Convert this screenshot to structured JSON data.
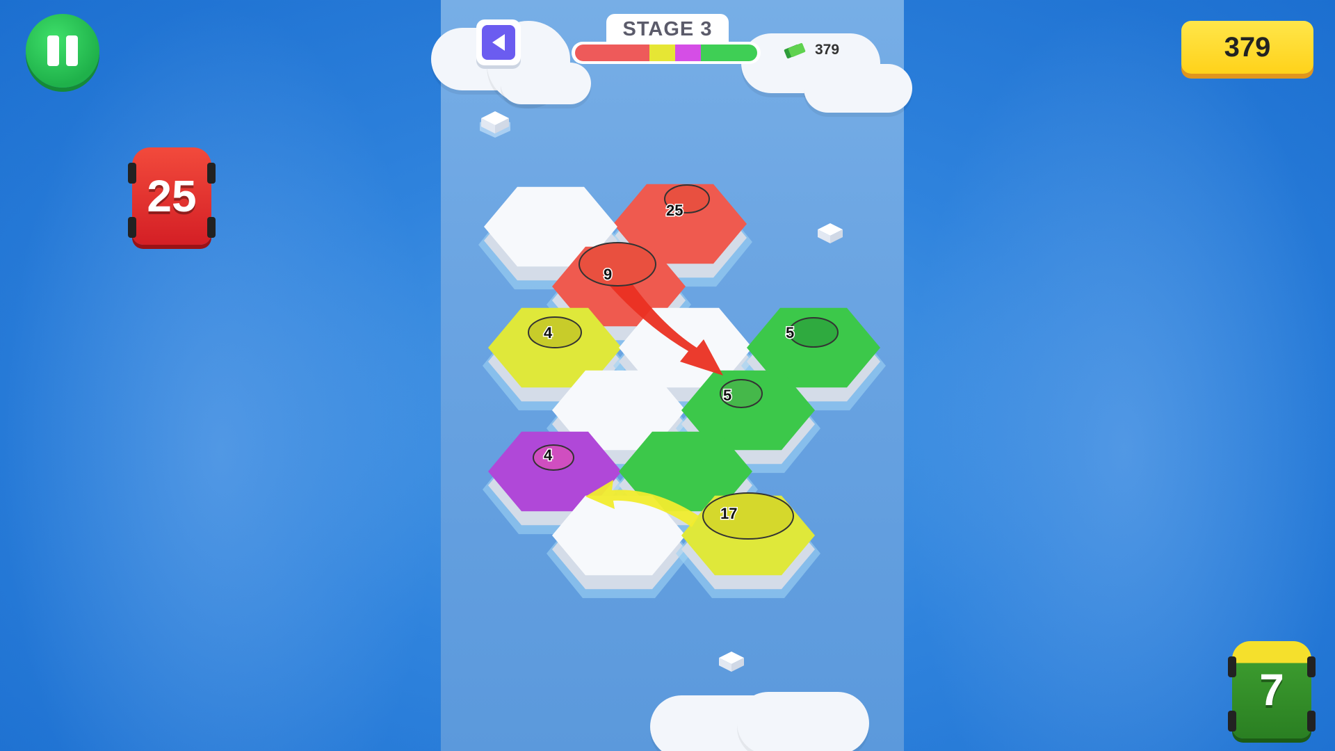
{
  "hud": {
    "stage_label": "STAGE 3",
    "cash": "379",
    "coins": "379",
    "progress": {
      "segments": [
        {
          "color": "#ee5a5a",
          "fraction": 0.41
        },
        {
          "color": "#e6e634",
          "fraction": 0.14
        },
        {
          "color": "#d54ee6",
          "fraction": 0.14
        },
        {
          "color": "#3fcf55",
          "fraction": 0.31
        }
      ]
    }
  },
  "players": {
    "red": {
      "count": "25",
      "color": "#e0242b"
    },
    "green": {
      "count": "7",
      "color": "#2f8f2a"
    }
  },
  "units": {
    "red_base": "25",
    "red_tank": "9",
    "yellow_tank": "4",
    "green_top": "5",
    "green_mid": "5",
    "purple_tank": "4",
    "yellow_apc": "17"
  },
  "colors": {
    "red_tile": "#ef5a4f",
    "yellow_tile": "#dfe83a",
    "green_tile": "#3cc84a",
    "purple_tile": "#b048d8",
    "neutral_tile": "#f7f9fc"
  }
}
